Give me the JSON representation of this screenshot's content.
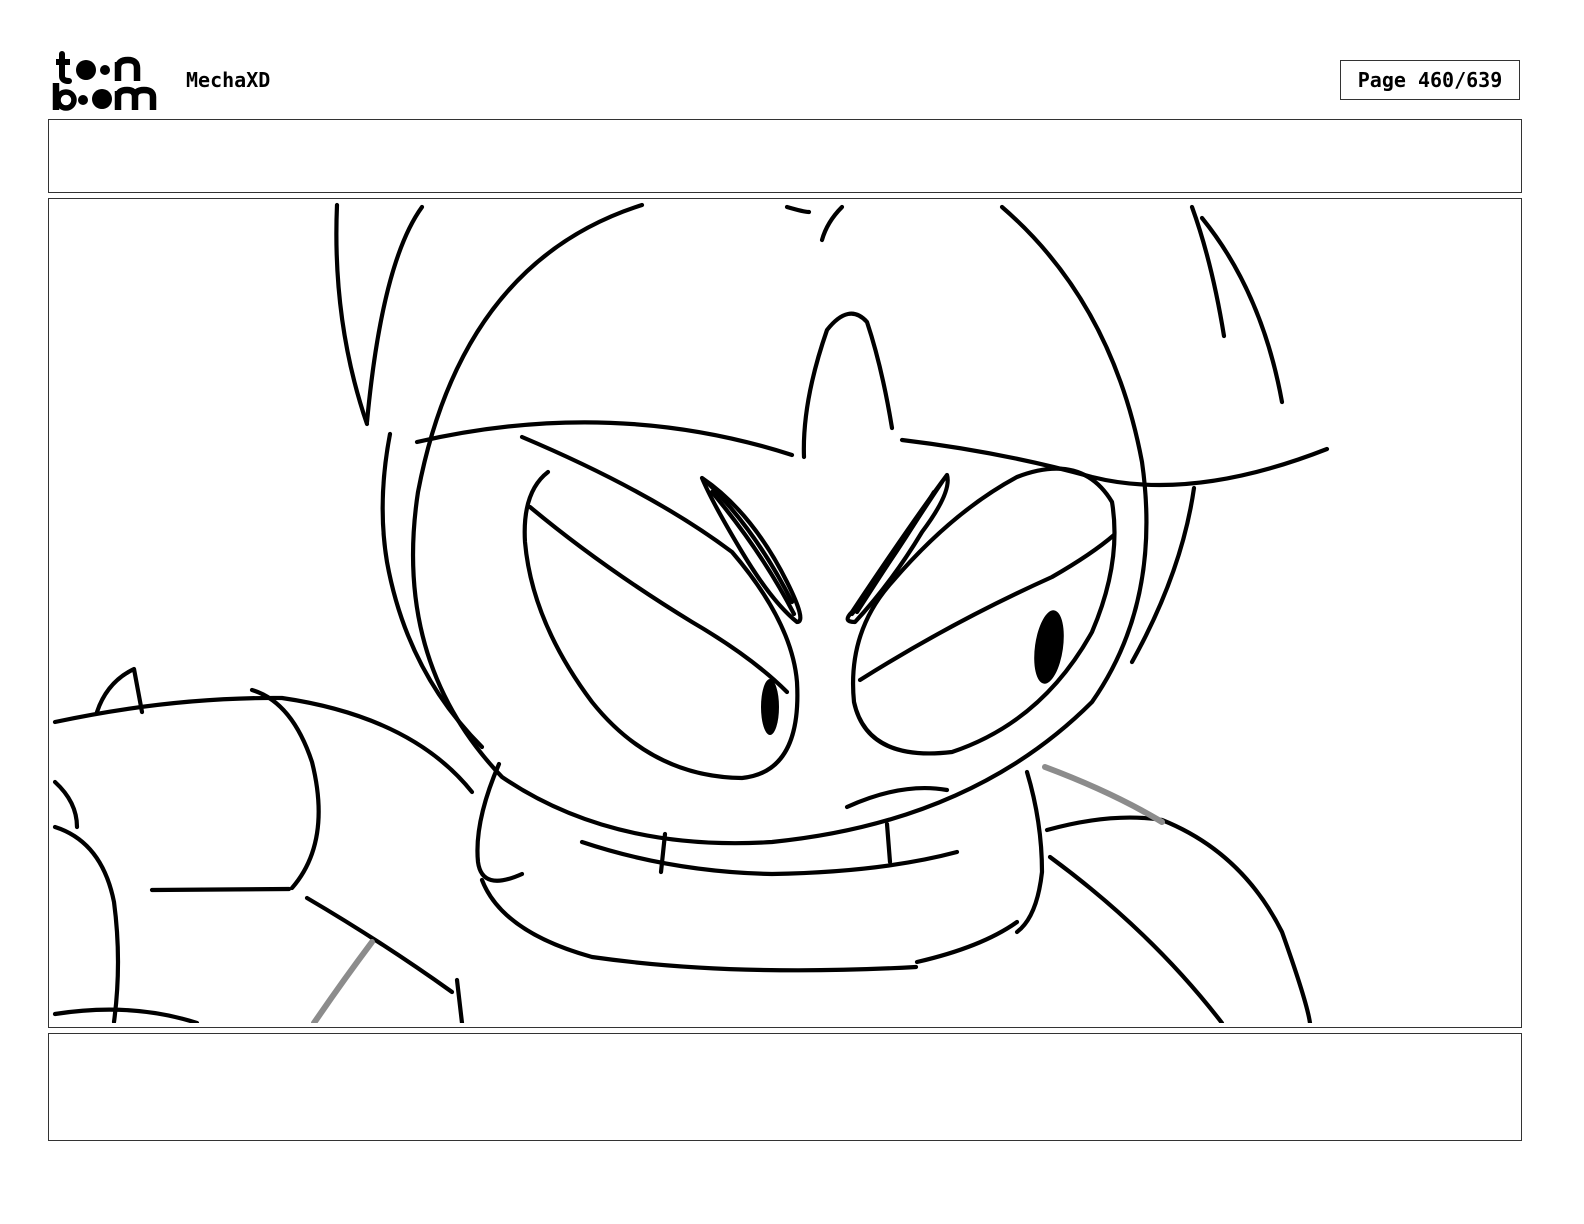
{
  "header": {
    "logo_top": "t●●n",
    "logo_bottom": "b●●m",
    "project_title": "MechaXD",
    "page_counter": "Page 460/639"
  },
  "panel": {
    "top_notes": "",
    "bottom_notes": ""
  },
  "colors": {
    "stroke": "#000000",
    "guide_stroke": "#8c8c8c",
    "frame_border": "#333333",
    "background": "#ffffff"
  }
}
